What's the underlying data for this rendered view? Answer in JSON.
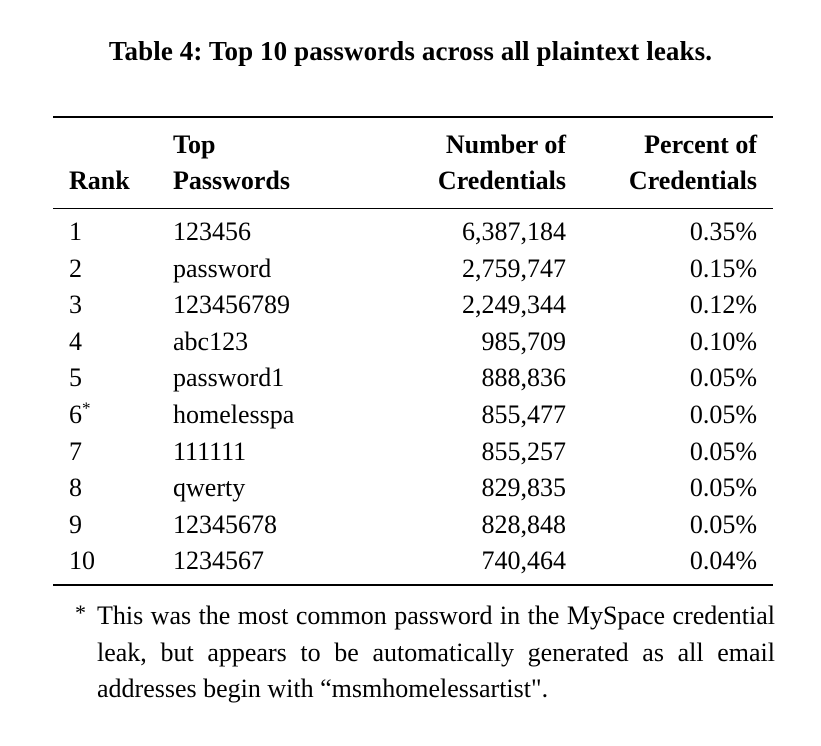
{
  "caption": "Table 4: Top 10 passwords across all plaintext leaks.",
  "table": {
    "headers": {
      "rank": [
        "",
        "Rank"
      ],
      "password": [
        "Top",
        "Passwords"
      ],
      "count": [
        "Number of",
        "Credentials"
      ],
      "percent": [
        "Percent of",
        "Credentials"
      ]
    },
    "rows": [
      {
        "rank": "1",
        "mark": "",
        "password": "123456",
        "count": "6,387,184",
        "percent": "0.35%"
      },
      {
        "rank": "2",
        "mark": "",
        "password": "password",
        "count": "2,759,747",
        "percent": "0.15%"
      },
      {
        "rank": "3",
        "mark": "",
        "password": "123456789",
        "count": "2,249,344",
        "percent": "0.12%"
      },
      {
        "rank": "4",
        "mark": "",
        "password": "abc123",
        "count": "985,709",
        "percent": "0.10%"
      },
      {
        "rank": "5",
        "mark": "",
        "password": "password1",
        "count": "888,836",
        "percent": "0.05%"
      },
      {
        "rank": "6",
        "mark": "*",
        "password": "homelesspa",
        "count": "855,477",
        "percent": "0.05%"
      },
      {
        "rank": "7",
        "mark": "",
        "password": "111111",
        "count": "855,257",
        "percent": "0.05%"
      },
      {
        "rank": "8",
        "mark": "",
        "password": "qwerty",
        "count": "829,835",
        "percent": "0.05%"
      },
      {
        "rank": "9",
        "mark": "",
        "password": "12345678",
        "count": "828,848",
        "percent": "0.05%"
      },
      {
        "rank": "10",
        "mark": "",
        "password": "1234567",
        "count": "740,464",
        "percent": "0.04%"
      }
    ]
  },
  "footnote": {
    "mark": "*",
    "text": "This was the most common password in the MySpace credential leak, but appears to be automatically generated as all email addresses begin with “msmhomelessartist\"."
  }
}
